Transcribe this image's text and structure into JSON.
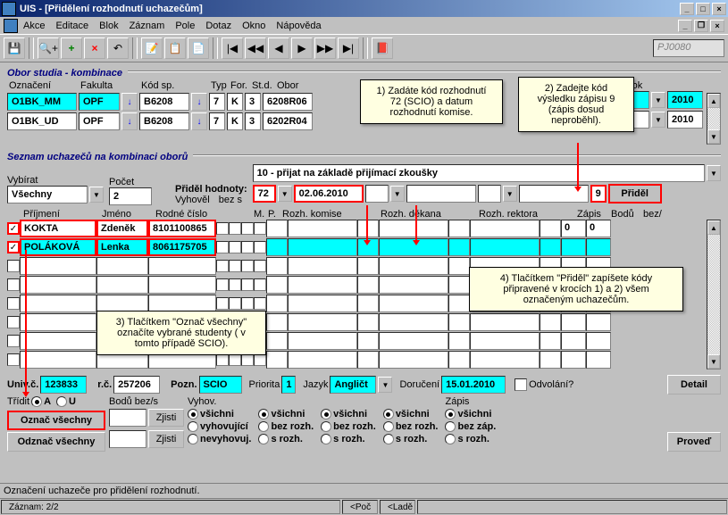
{
  "window": {
    "title": "UIS - [Přidělení rozhodnutí uchazečům]"
  },
  "menu": {
    "items": [
      "Akce",
      "Editace",
      "Blok",
      "Záznam",
      "Pole",
      "Dotaz",
      "Okno",
      "Nápověda"
    ]
  },
  "toolbar": {
    "field_value": "PJ0080"
  },
  "group1": {
    "title": "Obor studia - kombinace",
    "headers": {
      "oznaceni": "Označení",
      "fakulta": "Fakulta",
      "kod_sp": "Kód sp.",
      "typ": "Typ",
      "for": "For.",
      "std": "St.d.",
      "obor": "Obor",
      "rok": "Rok"
    },
    "rows": [
      {
        "oznaceni": "O1BK_MM",
        "fakulta": "OPF",
        "kod_sp": "B6208",
        "typ": "7",
        "for": "K",
        "std": "3",
        "obor": "6208R06",
        "rok": "2010"
      },
      {
        "oznaceni": "O1BK_UD",
        "fakulta": "OPF",
        "kod_sp": "B6208",
        "typ": "7",
        "for": "K",
        "std": "3",
        "obor": "6202R04",
        "rok": "2010"
      }
    ]
  },
  "group2": {
    "title": "Seznam uchazečů na kombinaci oborů",
    "vybirat_label": "Vybírat",
    "vybirat_value": "Všechny",
    "pocet_label": "Počet",
    "pocet_value": "2",
    "pridel_hodnoty_label": "Přiděl hodnoty:",
    "vyhovel_label": "Vyhověl",
    "bez_s_label": "bez s",
    "combo_top": "10 - přijat na základě přijímací zkoušky",
    "code_value": "72",
    "date_value": "02.06.2010",
    "zapis_value": "9",
    "pridel_btn": "Přiděl",
    "table_headers": {
      "prijmeni": "Příjmení",
      "jmeno": "Jméno",
      "rodne_cislo": "Rodné číslo",
      "m": "M.",
      "p": "P.",
      "rozh_komise": "Rozh. komise",
      "rozh_dekana": "Rozh. děkana",
      "rozh_rektora": "Rozh. rektora",
      "zapis": "Zápis",
      "bodu": "Bodů",
      "bez": "bez/"
    },
    "applicants": [
      {
        "checked": true,
        "prijmeni": "KOKTA",
        "jmeno": "Zdeněk",
        "rodne_cislo": "8101100865",
        "bodu": "0",
        "bez": "0"
      },
      {
        "checked": true,
        "prijmeni": "POLÁKOVÁ",
        "jmeno": "Lenka",
        "rodne_cislo": "8061175705",
        "bodu": "",
        "bez": ""
      }
    ]
  },
  "bottom": {
    "univ_c_label": "Univ.č.",
    "univ_c_value": "123833",
    "rc_label": "r.č.",
    "rc_value": "257206",
    "pozn_label": "Pozn.",
    "pozn_value": "SCIO",
    "priorita_label": "Priorita",
    "priorita_value": "1",
    "jazyk_label": "Jazyk",
    "jazyk_value": "Angličt",
    "doruceni_label": "Doručení",
    "doruceni_value": "15.01.2010",
    "odvolani_label": "Odvolání?",
    "detail_btn": "Detail",
    "tridit_label": "Třídit",
    "tridit_a": "A",
    "tridit_u": "U",
    "bodu_bez_s_label": "Bodů bez/s",
    "vyhov_label": "Vyhov.",
    "zapis_label": "Zápis",
    "oznac_vsechny": "Označ všechny",
    "odznac_vsechny": "Odznač všechny",
    "zjisti": "Zjisti",
    "proved": "Proveď",
    "radio_options": {
      "vsichni": "všichni",
      "vyhovujici": "vyhovující",
      "nevyhovuj": "nevyhovuj.",
      "bez_rozh": "bez rozh.",
      "s_rozh": "s rozh.",
      "bez_zap": "bez záp.",
      "s_rozh2": "s rozh."
    }
  },
  "callouts": {
    "c1": "1) Zadáte kód rozhodnutí 72 (SCIO) a datum rozhodnutí komise.",
    "c2": "2) Zadejte kód výsledku zápisu 9 (zápis dosud neproběhl).",
    "c3": "3) Tlačítkem \"Označ všechny\" označíte vybrané studenty ( v tomto případě SCIO).",
    "c4": "4) Tlačítkem \"Přiděl\" zapíšete kódy připravené v krocích 1) a 2) všem označeným uchazečům."
  },
  "status": {
    "line1": "Označení uchazeče pro přidělení rozhodnutí.",
    "line2": "Záznam: 2/2",
    "panel1": "<Poč",
    "panel2": "<Ladě"
  }
}
